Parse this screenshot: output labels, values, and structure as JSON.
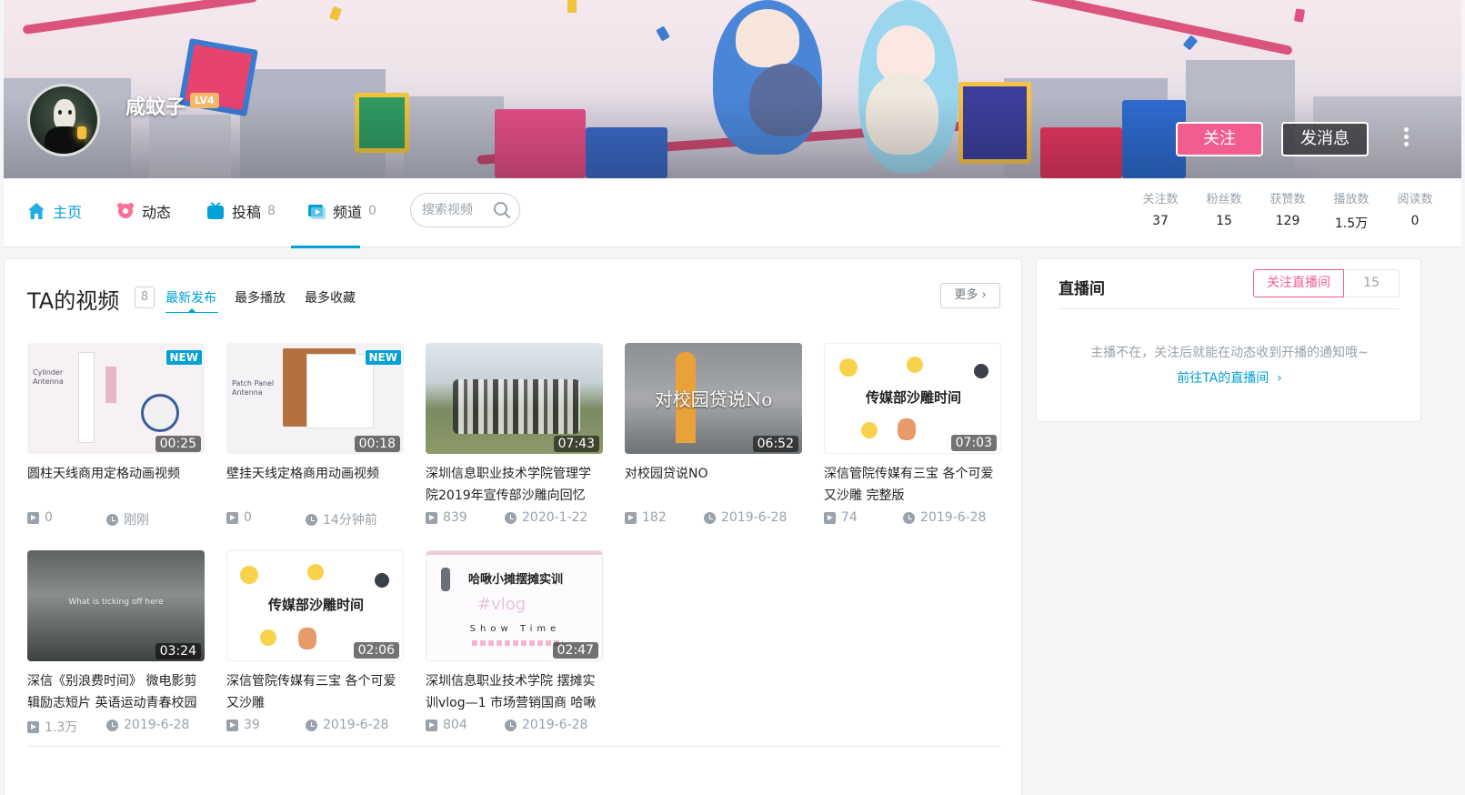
{
  "profile": {
    "username": "咸蚊子",
    "level": "LV4",
    "follow_label": "关注",
    "message_label": "发消息"
  },
  "nav": {
    "home": "主页",
    "dynamic": "动态",
    "submissions": "投稿",
    "submissions_count": "8",
    "channels": "频道",
    "channels_count": "0",
    "search_placeholder": "搜索视频"
  },
  "stats": [
    {
      "label": "关注数",
      "value": "37"
    },
    {
      "label": "粉丝数",
      "value": "15"
    },
    {
      "label": "获赞数",
      "value": "129"
    },
    {
      "label": "播放数",
      "value": "1.5万"
    },
    {
      "label": "阅读数",
      "value": "0"
    }
  ],
  "videos_section": {
    "title": "TA的视频",
    "count": "8",
    "tabs": [
      "最新发布",
      "最多播放",
      "最多收藏"
    ],
    "more": "更多"
  },
  "videos": [
    {
      "title": "圆柱天线商用定格动画视频",
      "duration": "00:25",
      "badge": "NEW",
      "plays": "0",
      "date": "刚刚",
      "thumb_text": "Cylinder Antenna"
    },
    {
      "title": "壁挂天线定格商用动画视频",
      "duration": "00:18",
      "badge": "NEW",
      "plays": "0",
      "date": "14分钟前",
      "thumb_text": "Patch Panel Antenna"
    },
    {
      "title": "深圳信息职业技术学院管理学院2019年宣传部沙雕向回忆",
      "duration": "07:43",
      "plays": "839",
      "date": "2020-1-22"
    },
    {
      "title": "对校园贷说NO",
      "duration": "06:52",
      "plays": "182",
      "date": "2019-6-28",
      "thumb_text": "对校园贷说No"
    },
    {
      "title": "深信管院传媒有三宝 各个可爱又沙雕 完整版",
      "duration": "07:03",
      "plays": "74",
      "date": "2019-6-28",
      "thumb_text": "传媒部沙雕时间"
    },
    {
      "title": "深信《别浪费时间》 微电影剪辑励志短片 英语运动青春校园",
      "duration": "03:24",
      "plays": "1.3万",
      "date": "2019-6-28",
      "thumb_text": "What is ticking off here"
    },
    {
      "title": "深信管院传媒有三宝 各个可爱又沙雕",
      "duration": "02:06",
      "plays": "39",
      "date": "2019-6-28",
      "thumb_text": "传媒部沙雕时间"
    },
    {
      "title": "深圳信息职业技术学院 摆摊实训vlog—1 市场营销国商 哈啾",
      "duration": "02:47",
      "plays": "804",
      "date": "2019-6-28",
      "thumb_text": "哈啾小摊摆摊实训",
      "thumb_sub": "Show Time"
    }
  ],
  "live": {
    "title": "直播间",
    "follow_label": "关注直播间",
    "follow_count": "15",
    "message": "主播不在，关注后就能在动态收到开播的通知哦~",
    "link": "前往TA的直播间"
  },
  "colors": {
    "accent_blue": "#00a1d6",
    "accent_pink": "#f25d8e",
    "muted": "#99a2aa"
  }
}
